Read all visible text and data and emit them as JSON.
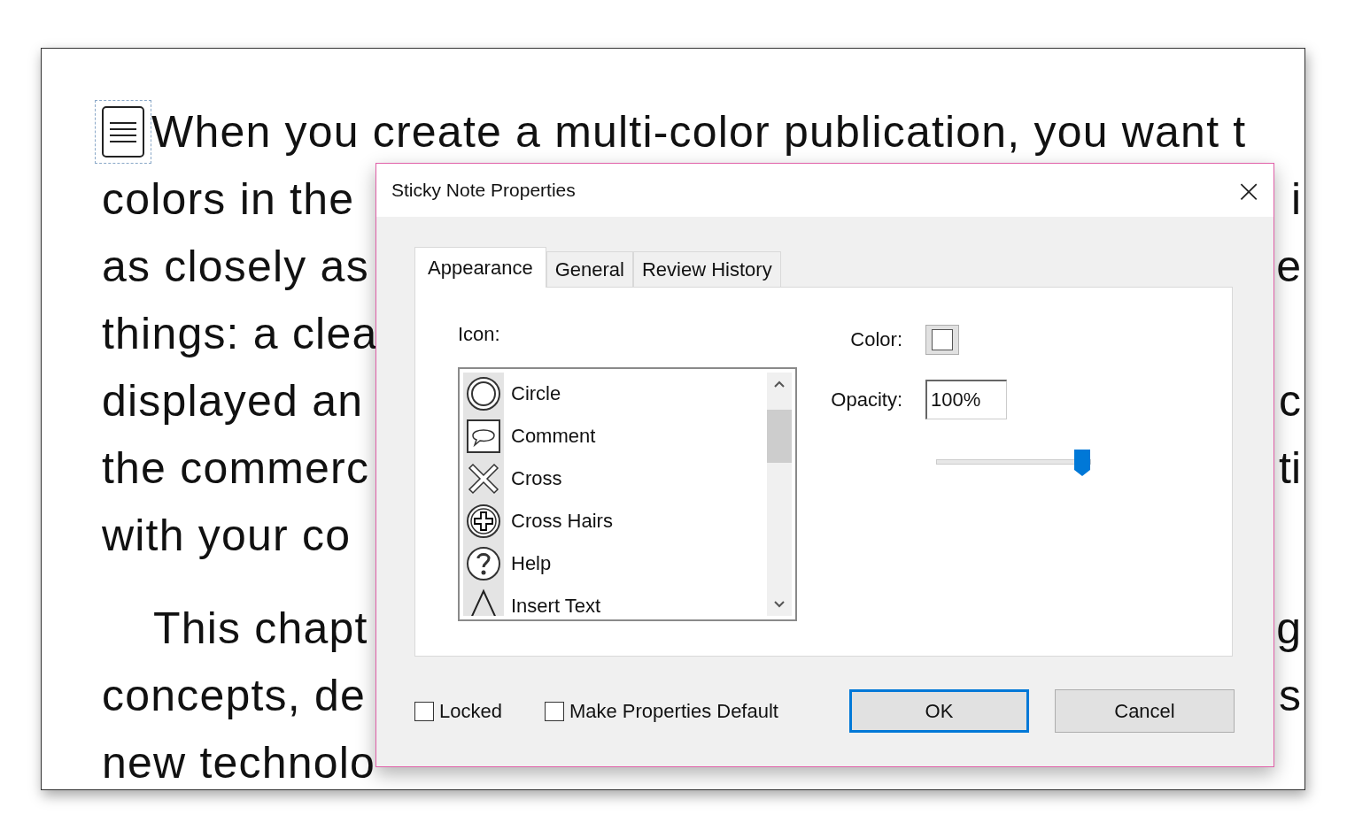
{
  "document": {
    "lines": [
      {
        "kind": "noted",
        "text": "When you create a multi-color publication, you want t"
      },
      {
        "kind": "plain",
        "text": "colors in the",
        "fragment": "i"
      },
      {
        "kind": "plain",
        "text": "as closely as",
        "fragment": "e"
      },
      {
        "kind": "plain",
        "text": "things: a clea"
      },
      {
        "kind": "plain",
        "text": "displayed an",
        "fragment": "c"
      },
      {
        "kind": "plain",
        "text": "the commerc",
        "fragment": "ti"
      },
      {
        "kind": "plain",
        "text": "with your co"
      },
      {
        "kind": "indented",
        "text": "This chapt",
        "fragment": "g"
      },
      {
        "kind": "plain",
        "text": "concepts, de",
        "fragment": "s"
      },
      {
        "kind": "plain",
        "text": "new technolo"
      }
    ]
  },
  "dialog": {
    "title": "Sticky Note Properties",
    "close": "×",
    "tabs": [
      {
        "label": "Appearance",
        "selected": true
      },
      {
        "label": "General",
        "selected": false
      },
      {
        "label": "Review History",
        "selected": false
      }
    ],
    "icon_label": "Icon:",
    "icons": [
      {
        "kind": "circle",
        "label": "Circle"
      },
      {
        "kind": "comment",
        "label": "Comment"
      },
      {
        "kind": "cross",
        "label": "Cross"
      },
      {
        "kind": "crosshairs",
        "label": "Cross Hairs"
      },
      {
        "kind": "help",
        "label": "Help"
      },
      {
        "kind": "inserttext",
        "label": "Insert Text"
      }
    ],
    "color_label": "Color:",
    "opacity_label": "Opacity:",
    "opacity_value": "100%",
    "opacity_slider": {
      "level": 1
    },
    "checkboxes": [
      {
        "label": "Locked",
        "checked": false
      },
      {
        "label": "Make Properties Default",
        "checked": false
      }
    ],
    "buttons": [
      {
        "label": "OK",
        "default": true
      },
      {
        "label": "Cancel",
        "default": false
      }
    ]
  }
}
